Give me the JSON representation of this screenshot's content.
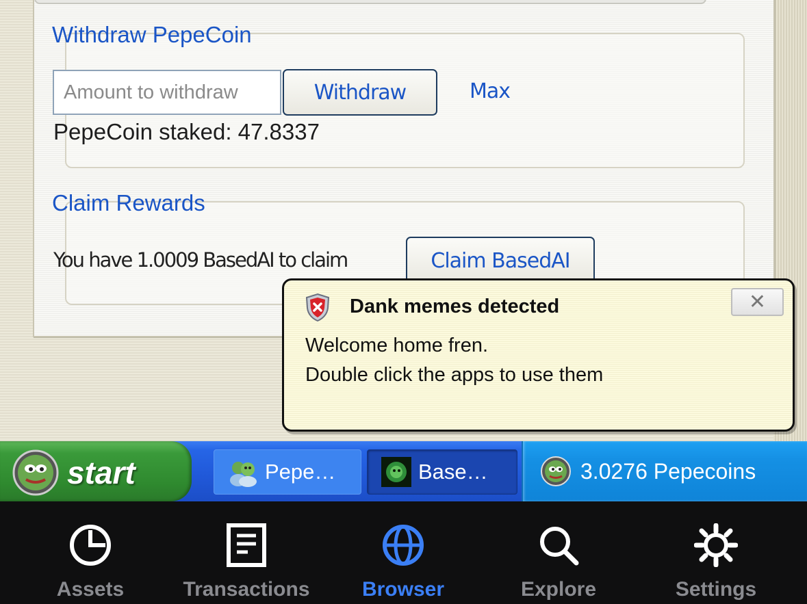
{
  "withdraw_section": {
    "title": "Withdraw PepeCoin",
    "amount_placeholder": "Amount to withdraw",
    "withdraw_label": "Withdraw",
    "max_label": "Max",
    "staked_text": "PepeCoin staked: 47.8337"
  },
  "claim_section": {
    "title": "Claim Rewards",
    "claim_text": "You have 1.0009 BasedAI to claim",
    "claim_label": "Claim BasedAI"
  },
  "balloon": {
    "title": "Dank memes detected",
    "line1": "Welcome home fren.",
    "line2": "Double click the apps to use them",
    "close_label": "✕",
    "icon": "shield-icon"
  },
  "taskbar": {
    "start_label": "start",
    "items": [
      {
        "label": "Pepe…",
        "icon": "pepe-messenger-icon"
      },
      {
        "label": "Base…",
        "icon": "basedai-icon"
      }
    ],
    "tray_label": "3.0276 Pepecoins"
  },
  "bottom_nav": {
    "items": [
      {
        "label": "Assets",
        "icon": "pie-chart-icon"
      },
      {
        "label": "Transactions",
        "icon": "document-icon"
      },
      {
        "label": "Browser",
        "icon": "globe-icon",
        "active": true
      },
      {
        "label": "Explore",
        "icon": "search-icon"
      },
      {
        "label": "Settings",
        "icon": "gear-icon"
      }
    ]
  },
  "colors": {
    "link_blue": "#1a55c6",
    "nav_active": "#3b7ff5",
    "nav_inactive": "#8a8b90",
    "taskbar_blue": "#2058d8",
    "start_green": "#3a9a3a",
    "balloon_bg": "#fdfbe0"
  }
}
